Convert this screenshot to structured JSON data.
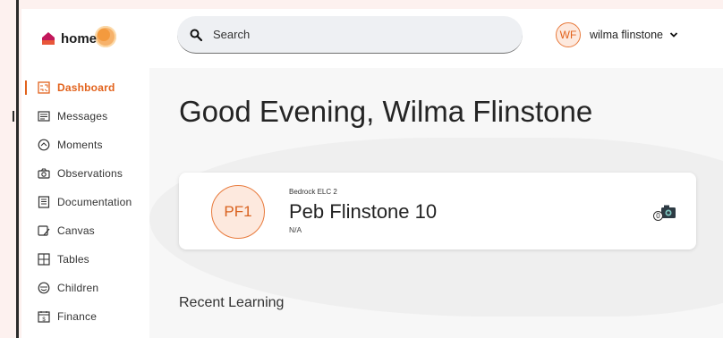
{
  "header": {
    "logo_text": "home",
    "search": {
      "placeholder": "Search",
      "value": ""
    },
    "user": {
      "initials": "WF",
      "name": "wilma flinstone"
    }
  },
  "sidebar": {
    "items": [
      {
        "label": "Dashboard",
        "icon": "dashboard-icon",
        "active": true
      },
      {
        "label": "Messages",
        "icon": "messages-icon"
      },
      {
        "label": "Moments",
        "icon": "moments-icon"
      },
      {
        "label": "Observations",
        "icon": "camera-icon"
      },
      {
        "label": "Documentation",
        "icon": "documentation-icon"
      },
      {
        "label": "Canvas",
        "icon": "canvas-icon"
      },
      {
        "label": "Tables",
        "icon": "tables-icon"
      },
      {
        "label": "Children",
        "icon": "children-icon"
      },
      {
        "label": "Finance",
        "icon": "finance-icon"
      }
    ]
  },
  "main": {
    "greeting": "Good Evening, Wilma Flinstone",
    "child_card": {
      "initials": "PF1",
      "room": "Bedrock ELC 2",
      "name": "Peb Flinstone 10",
      "subtitle": "N/A",
      "observation_count": "0"
    },
    "section_title": "Recent Learning"
  },
  "colors": {
    "accent": "#e2621c",
    "accent_light": "#fde9de",
    "page_bg": "#fdf1ef"
  }
}
